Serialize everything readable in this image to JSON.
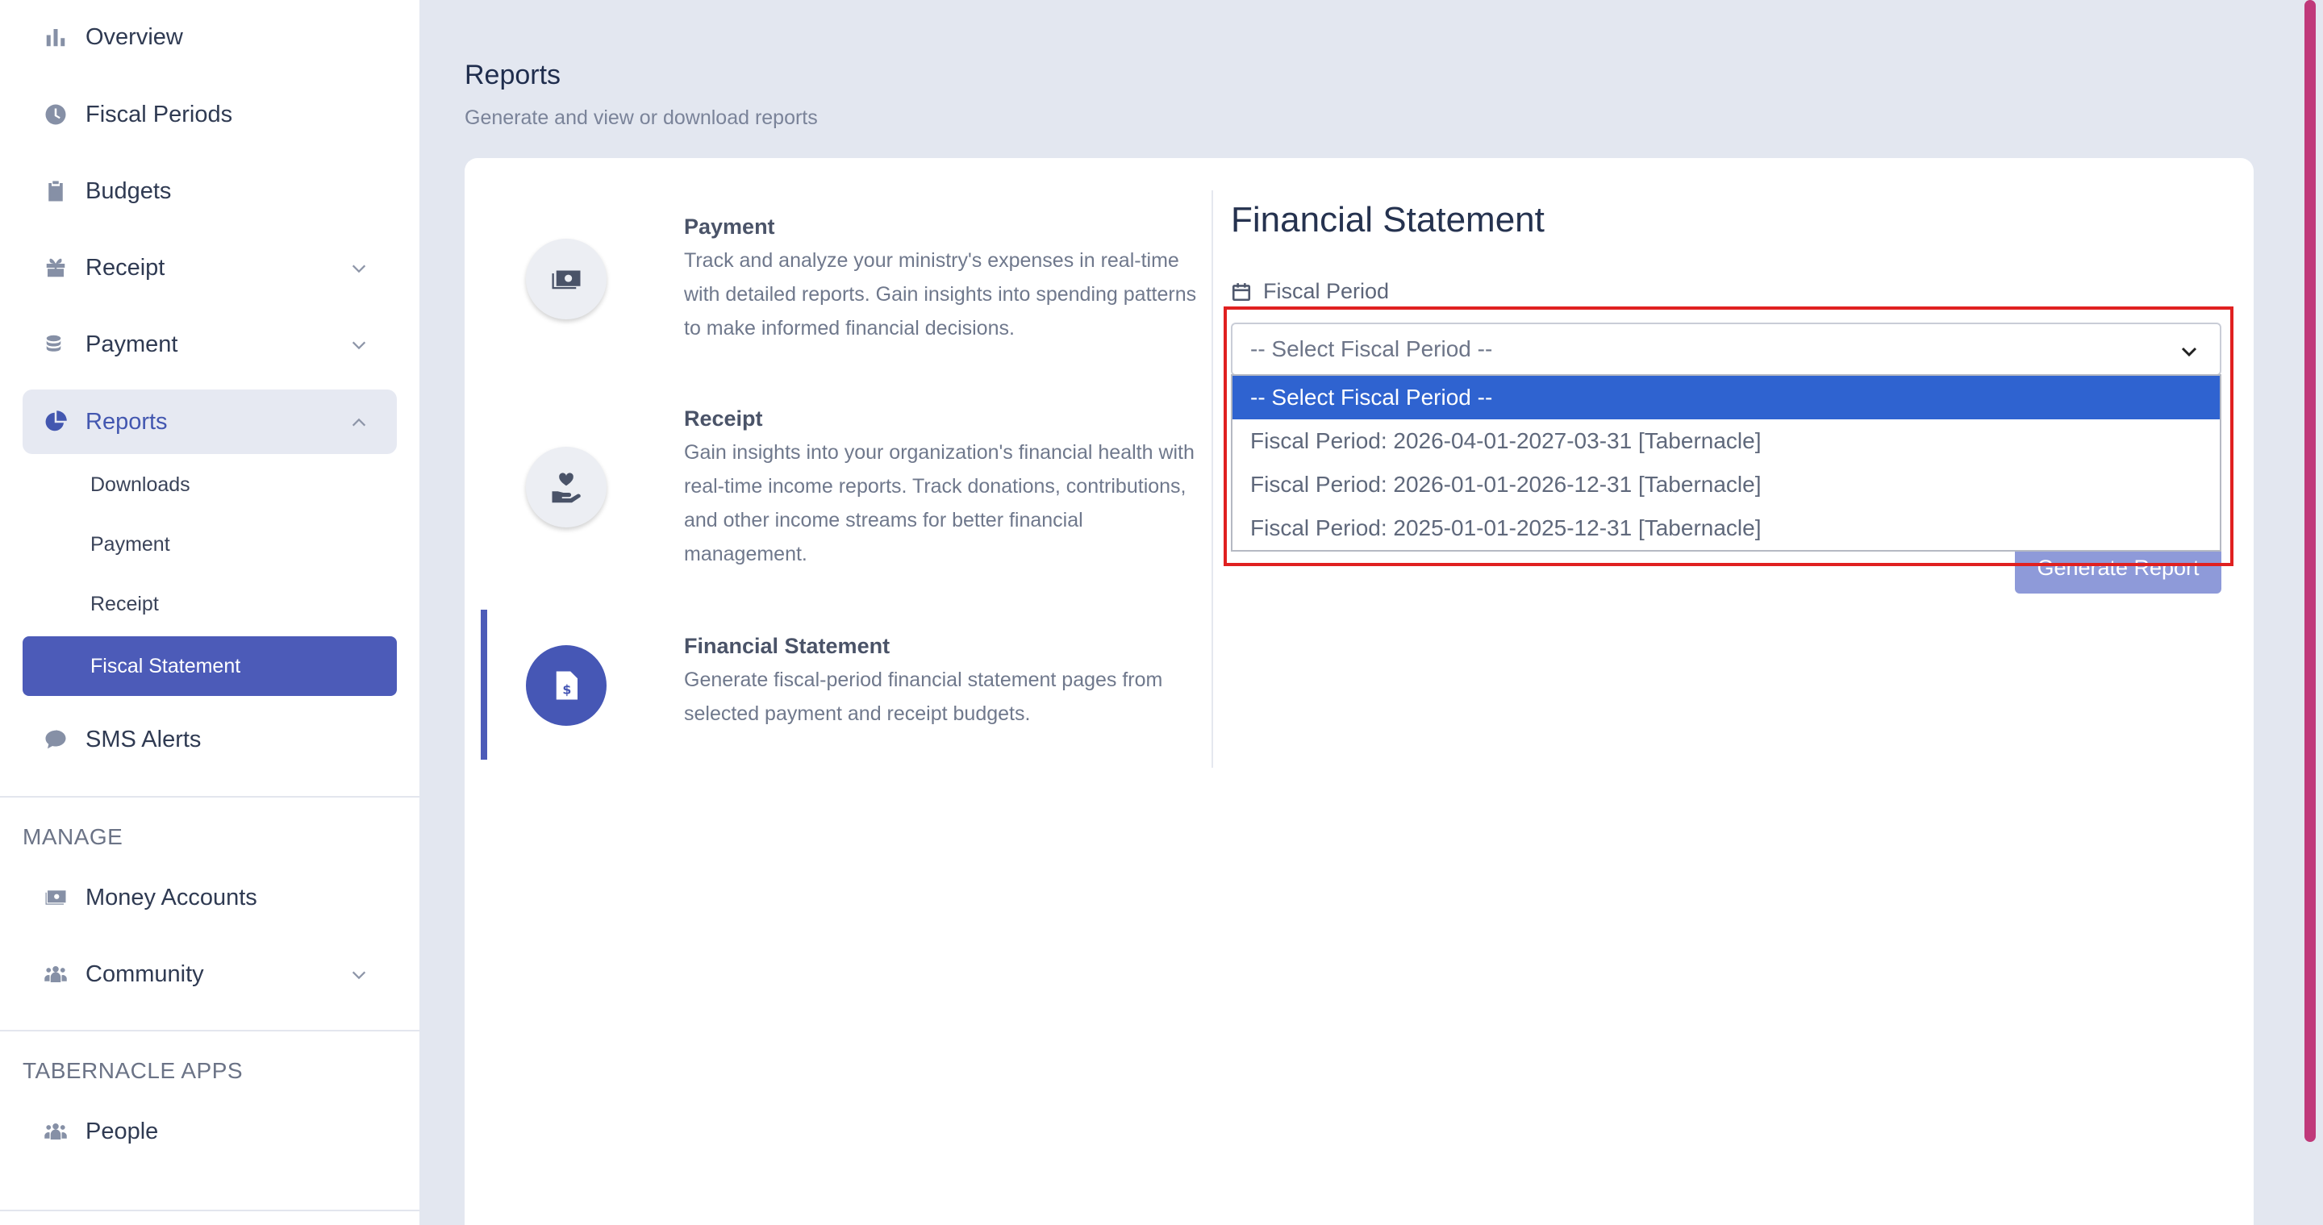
{
  "sidebar": {
    "items": [
      {
        "label": "Overview",
        "icon": "bar-chart-icon"
      },
      {
        "label": "Fiscal Periods",
        "icon": "clock-icon"
      },
      {
        "label": "Budgets",
        "icon": "clipboard-icon"
      },
      {
        "label": "Receipt",
        "icon": "gift-icon"
      },
      {
        "label": "Payment",
        "icon": "coins-icon"
      },
      {
        "label": "Reports",
        "icon": "pie-chart-icon"
      }
    ],
    "reports_sub": [
      "Downloads",
      "Payment",
      "Receipt",
      "Fiscal Statement"
    ],
    "sms": {
      "label": "SMS Alerts",
      "icon": "chat-icon"
    },
    "manage_label": "MANAGE",
    "manage_items": [
      {
        "label": "Money Accounts",
        "icon": "money-icon"
      },
      {
        "label": "Community",
        "icon": "users-icon"
      }
    ],
    "apps_label": "TABERNACLE APPS",
    "apps_items": [
      {
        "label": "People",
        "icon": "users-icon"
      }
    ]
  },
  "page": {
    "title": "Reports",
    "subtitle": "Generate and view or download reports"
  },
  "report_types": [
    {
      "title": "Payment",
      "description": "Track and analyze your ministry's expenses in real-time with detailed reports. Gain insights into spending patterns to make informed financial decisions.",
      "icon": "money-bill-icon"
    },
    {
      "title": "Receipt",
      "description": "Gain insights into your organization's financial health with real-time income reports. Track donations, contributions, and other income streams for better financial management.",
      "icon": "hand-heart-icon"
    },
    {
      "title": "Financial Statement",
      "description": "Generate fiscal-period financial statement pages from selected payment and receipt budgets.",
      "icon": "invoice-dollar-icon"
    }
  ],
  "form": {
    "title": "Financial Statement",
    "fiscal_period_label": "Fiscal Period",
    "select_value": "-- Select Fiscal Period --",
    "options": [
      "-- Select Fiscal Period --",
      "Fiscal Period: 2026-04-01-2027-03-31 [Tabernacle]",
      "Fiscal Period: 2026-01-01-2026-12-31 [Tabernacle]",
      "Fiscal Period: 2025-01-01-2025-12-31 [Tabernacle]"
    ],
    "selected_index": 0,
    "generate_label": "Generate Report"
  },
  "colors": {
    "accent": "#4c5bb8",
    "option_highlight": "#2f63d0",
    "annotation": "#e02020",
    "background": "#e3e7f0"
  }
}
